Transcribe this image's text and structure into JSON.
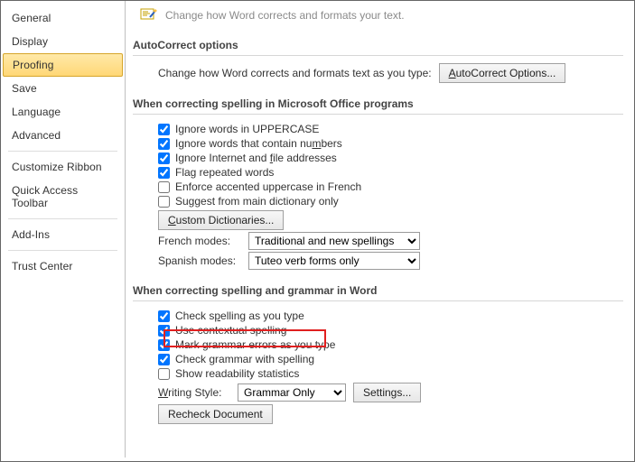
{
  "top_hint": "Change how Word corrects and formats your text.",
  "sidebar": {
    "items": [
      {
        "label": "General"
      },
      {
        "label": "Display"
      },
      {
        "label": "Proofing",
        "active": true
      },
      {
        "label": "Save"
      },
      {
        "label": "Language"
      },
      {
        "label": "Advanced"
      },
      {
        "label": "Customize Ribbon"
      },
      {
        "label": "Quick Access Toolbar"
      },
      {
        "label": "Add-Ins"
      },
      {
        "label": "Trust Center"
      }
    ]
  },
  "sections": {
    "autocorrect": {
      "title": "AutoCorrect options",
      "desc": "Change how Word corrects and formats text as you type:",
      "button_pre": "A",
      "button_mid": "utoCorrect Options..."
    },
    "office": {
      "title": "When correcting spelling in Microsoft Office programs",
      "c1": "Ignore words in UPPERCASE",
      "c2_pre": "Ignore words that contain nu",
      "c2_u": "m",
      "c2_post": "bers",
      "c3_pre": "Ignore Internet and ",
      "c3_u": "f",
      "c3_post": "ile addresses",
      "c4": "Flag repeated words",
      "c5": "Enforce accented uppercase in French",
      "c6": "Suggest from main dictionary only",
      "custom_dicts_u": "C",
      "custom_dicts_post": "ustom Dictionaries...",
      "french_label": "French modes:",
      "french_value": "Traditional and new spellings",
      "spanish_label": "Spanish modes:",
      "spanish_value": "Tuteo verb forms only"
    },
    "word": {
      "title": "When correcting spelling and grammar in Word",
      "c1_pre": "Check s",
      "c1_u": "p",
      "c1_post": "elling as you type",
      "c2": "Use contextual spelling",
      "c3": "Mark grammar errors as you type",
      "c4": "Check grammar with spelling",
      "c5": "Show readability statistics",
      "writing_label_u": "W",
      "writing_label_post": "riting Style:",
      "writing_value": "Grammar Only",
      "settings_btn": "Settings...",
      "recheck_btn": "Recheck Document"
    }
  }
}
